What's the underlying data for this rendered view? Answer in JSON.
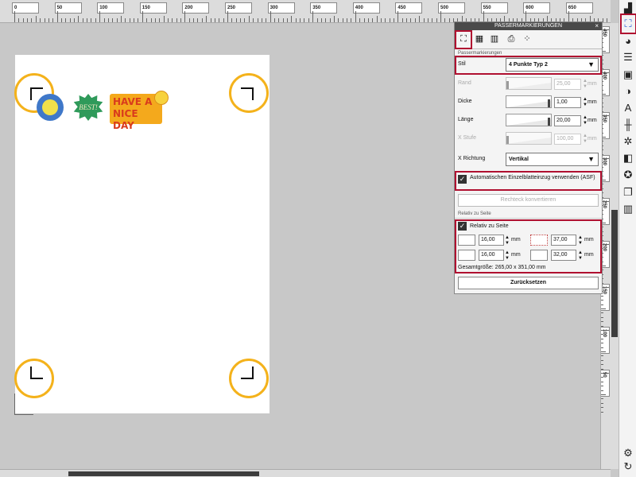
{
  "ruler_top": {
    "labels": [
      "0",
      "50",
      "100",
      "150",
      "200",
      "250",
      "300",
      "350",
      "400",
      "450",
      "500",
      "550",
      "600",
      "650"
    ]
  },
  "ruler_right": {
    "labels": [
      "450",
      "400",
      "350",
      "300",
      "250",
      "200",
      "150",
      "100",
      "50"
    ]
  },
  "stickers": {
    "best": "BEST!",
    "day_line1": "HAVE A",
    "day_line2": "NICE DAY"
  },
  "panel": {
    "title": "PASSERMARKIERUNGEN",
    "close": "×",
    "section_main": "Passermarkierungen",
    "stil_label": "Stil",
    "stil_value": "4 Punkte Typ 2",
    "rand_label": "Rand",
    "rand_value": "25,00",
    "dicke_label": "Dicke",
    "dicke_value": "1,00",
    "laenge_label": "Länge",
    "laenge_value": "20,00",
    "xstufe_label": "X Stufe",
    "xstufe_value": "100,00",
    "xrichtung_label": "X Richtung",
    "xrichtung_value": "Vertikal",
    "unit": "mm",
    "asf_label": "Automatischen Einzelblatteinzug verwenden (ASF)",
    "convert_button": "Rechteck konvertieren",
    "section_rel": "Relativ zu Seite",
    "rel_checkbox": "Relativ zu Seite",
    "rel_values": [
      "16,00",
      "37,00",
      "16,00",
      "32,00"
    ],
    "total_size": "Gesamtgröße: 265,00 x 351,00 mm",
    "reset_button": "Zurücksetzen"
  },
  "colors": {
    "highlight": "#b01030",
    "ring": "#f4b21b"
  }
}
